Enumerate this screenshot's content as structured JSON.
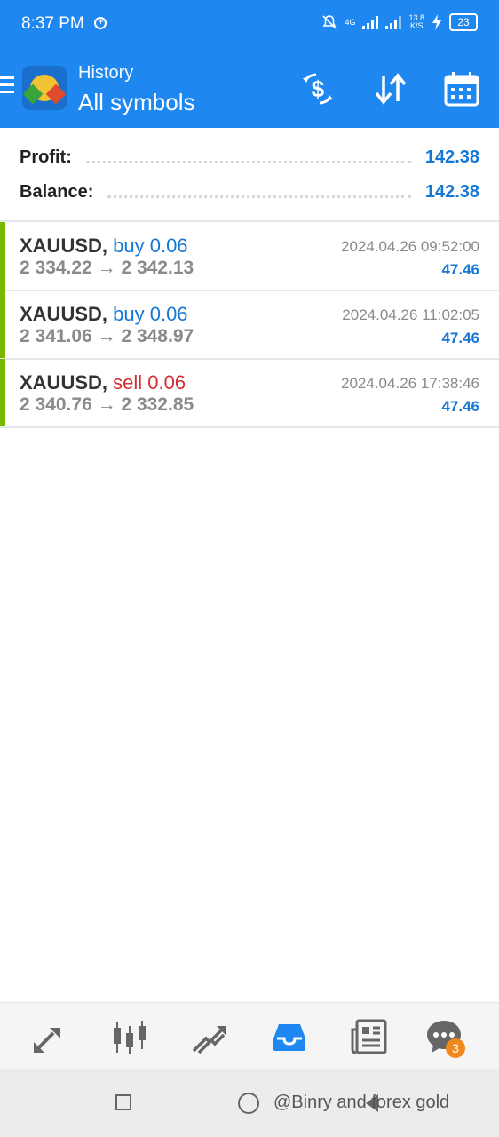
{
  "status_bar": {
    "time": "8:37 PM",
    "network": "4G",
    "speed": "13.8",
    "speed_unit": "K/S",
    "battery": "23"
  },
  "header": {
    "subtitle": "History",
    "title": "All symbols"
  },
  "summary": {
    "profit_label": "Profit:",
    "profit_value": "142.38",
    "balance_label": "Balance:",
    "balance_value": "142.38"
  },
  "trades": [
    {
      "symbol": "XAUUSD,",
      "type": "buy 0.06",
      "side": "buy",
      "open": "2 334.22",
      "close": "2 342.13",
      "time": "2024.04.26 09:52:00",
      "profit": "47.46"
    },
    {
      "symbol": "XAUUSD,",
      "type": "buy 0.06",
      "side": "buy",
      "open": "2 341.06",
      "close": "2 348.97",
      "time": "2024.04.26 11:02:05",
      "profit": "47.46"
    },
    {
      "symbol": "XAUUSD,",
      "type": "sell 0.06",
      "side": "sell",
      "open": "2 340.76",
      "close": "2 332.85",
      "time": "2024.04.26 17:38:46",
      "profit": "47.46"
    }
  ],
  "price_arrow": "→",
  "bottom_nav": {
    "chat_badge": "3"
  },
  "watermark": "@Binry and forex gold",
  "colors": {
    "primary": "#1e88f0",
    "buy": "#1678d6",
    "sell": "#d32f2f",
    "accent_bar": "#7ab800",
    "badge": "#f08a1e"
  },
  "icons": {
    "toolbar": [
      "dollar-sync-icon",
      "sort-icon",
      "calendar-icon"
    ],
    "bottom_nav": [
      "quotes-icon",
      "chart-icon",
      "trade-icon",
      "history-icon",
      "news-icon",
      "chat-icon"
    ]
  }
}
